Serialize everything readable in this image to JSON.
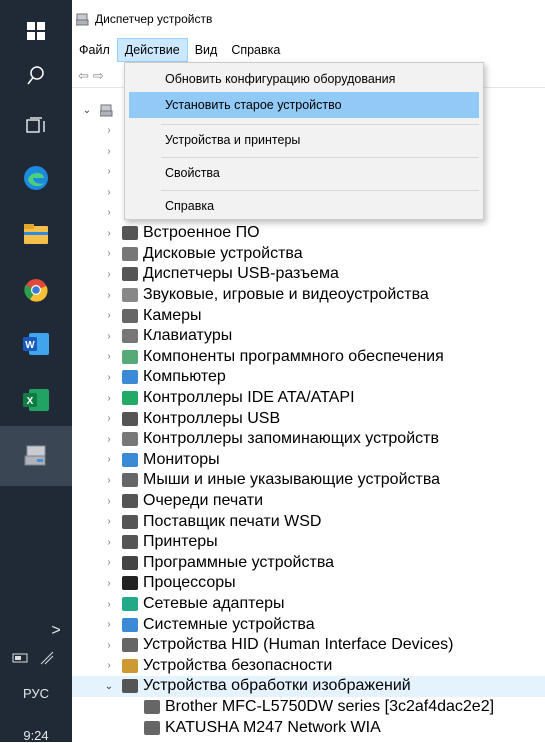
{
  "window": {
    "title": "Диспетчер устройств",
    "menu": [
      "Файл",
      "Действие",
      "Вид",
      "Справка"
    ],
    "toolbar": {
      "back": "⇦",
      "forward": "⇨"
    }
  },
  "dropdown": {
    "items": [
      "Обновить конфигурацию оборудования",
      "Установить старое устройство",
      "Устройства и принтеры",
      "Свойства",
      "Справка"
    ]
  },
  "tree": {
    "categories": [
      "Встроенное ПО",
      "Дисковые устройства",
      "Диспетчеры USB-разъема",
      "Звуковые, игровые и видеоустройства",
      "Камеры",
      "Клавиатуры",
      "Компоненты программного обеспечения",
      "Компьютер",
      "Контроллеры IDE ATA/ATAPI",
      "Контроллеры USB",
      "Контроллеры запоминающих устройств",
      "Мониторы",
      "Мыши и иные указывающие устройства",
      "Очереди печати",
      "Поставщик печати WSD",
      "Принтеры",
      "Программные устройства",
      "Процессоры",
      "Сетевые адаптеры",
      "Системные устройства",
      "Устройства HID (Human Interface Devices)",
      "Устройства безопасности",
      "Устройства обработки изображений"
    ],
    "children": [
      "Brother MFC-L5750DW series [3c2af4dac2e2]",
      "KATUSHA M247 Network WIA"
    ]
  },
  "taskbar": {
    "lang": "РУС",
    "time": "9:24",
    "chevron": ">"
  },
  "colors": {
    "taskbar_bg": "#1f2a36",
    "menu_highlight": "#91c9f7",
    "selection": "#e5f3ff"
  }
}
